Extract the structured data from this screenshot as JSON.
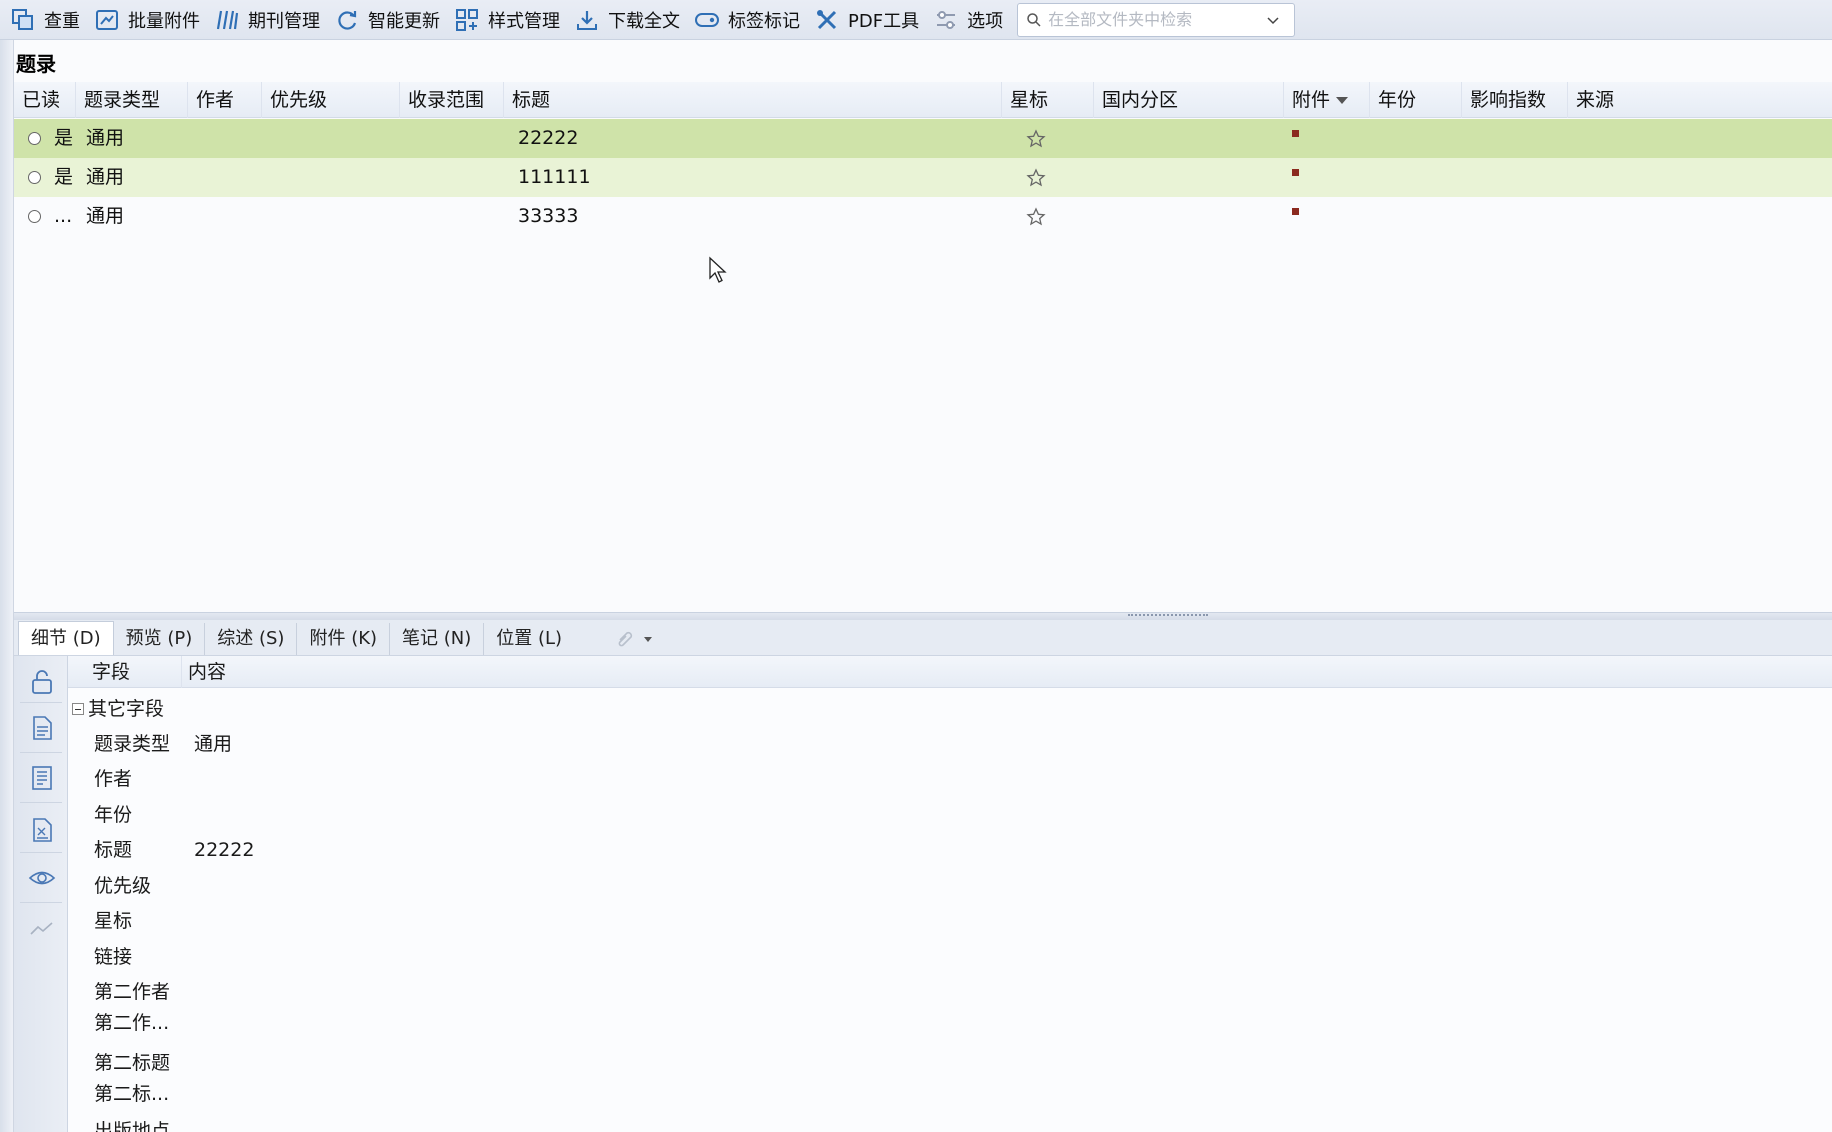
{
  "toolbar": {
    "items": [
      {
        "label": "查重",
        "icon": "duplicate-check-icon"
      },
      {
        "label": "批量附件",
        "icon": "batch-attachment-icon"
      },
      {
        "label": "期刊管理",
        "icon": "journal-icon"
      },
      {
        "label": "智能更新",
        "icon": "refresh-icon"
      },
      {
        "label": "样式管理",
        "icon": "style-grid-icon"
      },
      {
        "label": "下载全文",
        "icon": "download-icon"
      },
      {
        "label": "标签标记",
        "icon": "tag-icon"
      },
      {
        "label": "PDF工具",
        "icon": "tools-icon"
      },
      {
        "label": "选项",
        "icon": "options-icon"
      }
    ],
    "search_placeholder": "在全部文件夹中检索"
  },
  "list": {
    "title": "题录",
    "columns": [
      "已读",
      "题录类型",
      "作者",
      "优先级",
      "收录范围",
      "标题",
      "星标",
      "国内分区",
      "附件",
      "年份",
      "影响指数",
      "来源"
    ],
    "rows": [
      {
        "read": "是",
        "type": "通用",
        "title": "22222",
        "selected": true
      },
      {
        "read": "是",
        "type": "通用",
        "title": "111111",
        "selected": false
      },
      {
        "read": "...",
        "type": "通用",
        "title": "33333",
        "selected": false
      }
    ]
  },
  "tabs": [
    "细节 (D)",
    "预览 (P)",
    "综述 (S)",
    "附件 (K)",
    "笔记 (N)",
    "位置 (L)"
  ],
  "detail": {
    "headers": [
      "字段",
      "内容"
    ],
    "group": "其它字段",
    "fields": [
      {
        "name": "题录类型",
        "value": "通用"
      },
      {
        "name": "作者",
        "value": ""
      },
      {
        "name": "年份",
        "value": ""
      },
      {
        "name": "标题",
        "value": "22222"
      },
      {
        "name": "优先级",
        "value": ""
      },
      {
        "name": "星标",
        "value": ""
      },
      {
        "name": "链接",
        "value": ""
      },
      {
        "name": "第二作者",
        "name2": "第二作...",
        "value": ""
      },
      {
        "name": "第二标题",
        "name2": "第二标...",
        "value": ""
      },
      {
        "name": "出版地点",
        "value": ""
      }
    ]
  },
  "colors": {
    "selected_row": "#cfe3a9",
    "hover_row": "#e9f3d6",
    "attachment_marker": "#8b2a1f"
  }
}
